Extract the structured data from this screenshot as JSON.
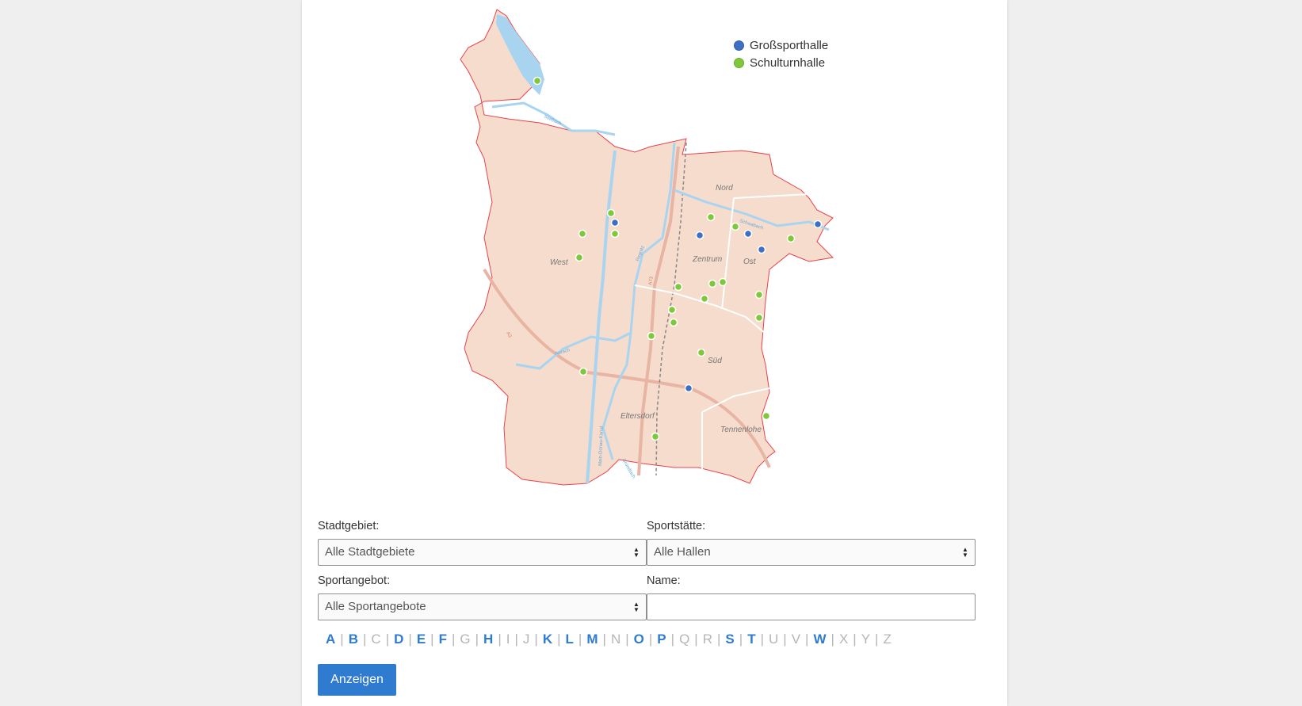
{
  "legend": [
    {
      "label": "Großsporthalle",
      "color": "#3d6fc4"
    },
    {
      "label": "Schulturnhalle",
      "color": "#7ec83b"
    }
  ],
  "map": {
    "district_labels": [
      "Nord",
      "West",
      "Zentrum",
      "Ost",
      "Süd",
      "Eltersdorf",
      "Tennenlohe"
    ],
    "river_labels": [
      "Seebach",
      "Schwabach",
      "Regnitz",
      "Aurach",
      "Main-Donau-Kanal",
      "Gründlach"
    ],
    "road_labels": [
      "A73",
      "A3"
    ],
    "colors": {
      "area_fill": "#f6dccc",
      "border": "#e8424a",
      "water": "#a8d4f0",
      "road": "#e8b4a4",
      "district_line": "#ffffff",
      "rail": "#888888"
    }
  },
  "form": {
    "stadtgebiet": {
      "label": "Stadtgebiet:",
      "value": "Alle Stadtgebiete"
    },
    "sportstaette": {
      "label": "Sportstätte:",
      "value": "Alle Hallen"
    },
    "sportangebot": {
      "label": "Sportangebot:",
      "value": "Alle Sportangebote"
    },
    "name": {
      "label": "Name:",
      "value": ""
    }
  },
  "alphabet": [
    {
      "letter": "A",
      "enabled": true
    },
    {
      "letter": "B",
      "enabled": true
    },
    {
      "letter": "C",
      "enabled": false
    },
    {
      "letter": "D",
      "enabled": true
    },
    {
      "letter": "E",
      "enabled": true
    },
    {
      "letter": "F",
      "enabled": true
    },
    {
      "letter": "G",
      "enabled": false
    },
    {
      "letter": "H",
      "enabled": true
    },
    {
      "letter": "I",
      "enabled": false
    },
    {
      "letter": "J",
      "enabled": false
    },
    {
      "letter": "K",
      "enabled": true
    },
    {
      "letter": "L",
      "enabled": true
    },
    {
      "letter": "M",
      "enabled": true
    },
    {
      "letter": "N",
      "enabled": false
    },
    {
      "letter": "O",
      "enabled": true
    },
    {
      "letter": "P",
      "enabled": true
    },
    {
      "letter": "Q",
      "enabled": false
    },
    {
      "letter": "R",
      "enabled": false
    },
    {
      "letter": "S",
      "enabled": true
    },
    {
      "letter": "T",
      "enabled": true
    },
    {
      "letter": "U",
      "enabled": false
    },
    {
      "letter": "V",
      "enabled": false
    },
    {
      "letter": "W",
      "enabled": true
    },
    {
      "letter": "X",
      "enabled": false
    },
    {
      "letter": "Y",
      "enabled": false
    },
    {
      "letter": "Z",
      "enabled": false
    }
  ],
  "submit_label": "Anzeigen"
}
